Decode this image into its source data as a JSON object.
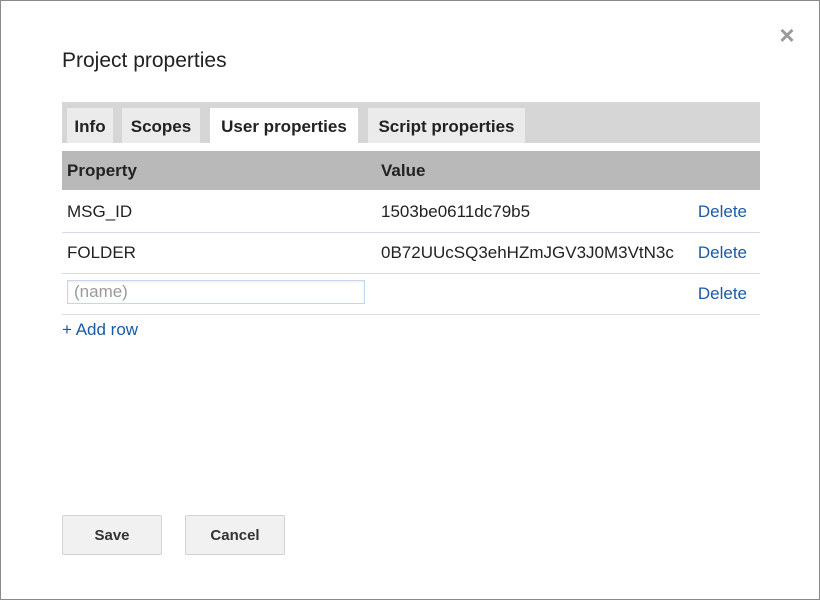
{
  "dialog": {
    "title": "Project properties",
    "close_icon": "close-icon"
  },
  "tabs": [
    {
      "label": "Info",
      "active": false
    },
    {
      "label": "Scopes",
      "active": false
    },
    {
      "label": "User properties",
      "active": true
    },
    {
      "label": "Script properties",
      "active": false
    }
  ],
  "table": {
    "headers": {
      "property": "Property",
      "value": "Value"
    },
    "rows": [
      {
        "property": "MSG_ID",
        "value": "1503be0611dc79b5",
        "delete_label": "Delete"
      },
      {
        "property": "FOLDER",
        "value": "0B72UUcSQ3ehHZmJGV3J0M3VtN3c",
        "delete_label": "Delete"
      }
    ],
    "new_row": {
      "placeholder": "(name)",
      "value": "",
      "delete_label": "Delete"
    },
    "add_row_label": "+ Add row"
  },
  "buttons": {
    "save_label": "Save",
    "cancel_label": "Cancel"
  }
}
